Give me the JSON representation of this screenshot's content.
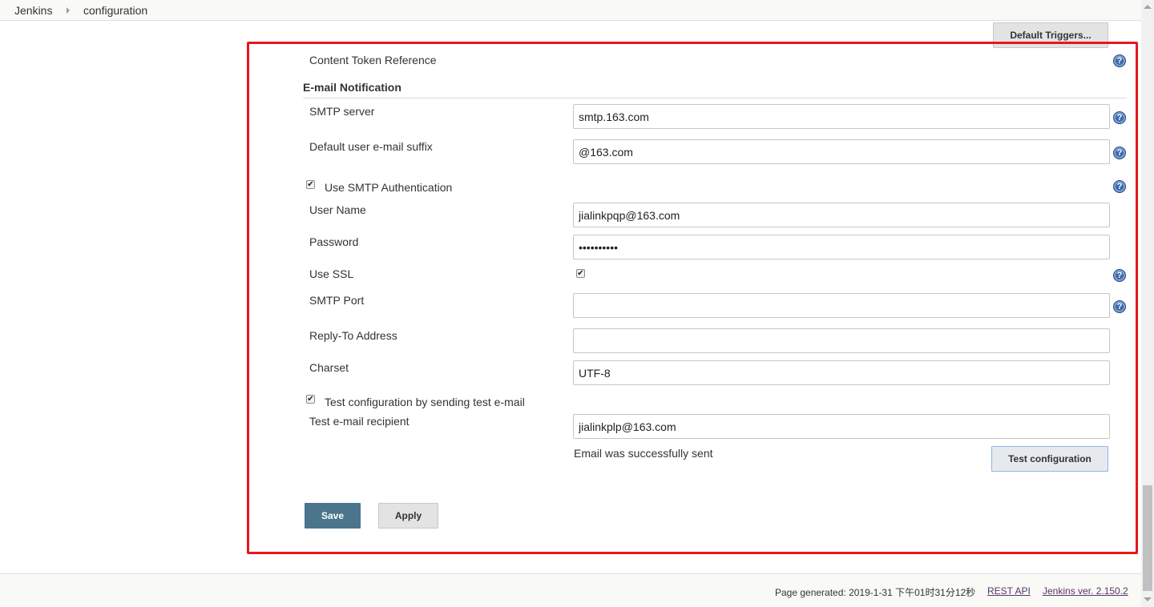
{
  "breadcrumb": {
    "root": "Jenkins",
    "current": "configuration"
  },
  "buttons": {
    "default_triggers": "Default Triggers...",
    "test_configuration": "Test configuration",
    "save": "Save",
    "apply": "Apply"
  },
  "content_token_reference": "Content Token Reference",
  "email_notification": {
    "header": "E-mail Notification",
    "smtp_server": {
      "label": "SMTP server",
      "value": "smtp.163.com"
    },
    "default_suffix": {
      "label": "Default user e-mail suffix",
      "value": "@163.com"
    },
    "use_smtp_auth": {
      "label": "Use SMTP Authentication",
      "checked": true
    },
    "user_name": {
      "label": "User Name",
      "value": "jialinkpqp@163.com"
    },
    "password": {
      "label": "Password",
      "value": "••••••••••"
    },
    "use_ssl": {
      "label": "Use SSL",
      "checked": true
    },
    "smtp_port": {
      "label": "SMTP Port",
      "value": ""
    },
    "reply_to": {
      "label": "Reply-To Address",
      "value": ""
    },
    "charset": {
      "label": "Charset",
      "value": "UTF-8"
    },
    "test_by_sending": {
      "label": "Test configuration by sending test e-mail",
      "checked": true
    },
    "test_recipient": {
      "label": "Test e-mail recipient",
      "value": "jialinkplp@163.com"
    },
    "status": "Email was successfully sent"
  },
  "footer": {
    "page_generated": "Page generated: 2019-1-31 下午01时31分12秒",
    "rest_api": "REST API",
    "version": "Jenkins ver. 2.150.2"
  },
  "icons": {
    "help": "help-icon",
    "checkbox_mark": "✔",
    "help_glyph": "?"
  },
  "colors": {
    "save_button": "#4b758b",
    "highlight_frame": "#e8171c",
    "help_icon": "#3b6aa8",
    "footer_link": "#5c3566"
  }
}
